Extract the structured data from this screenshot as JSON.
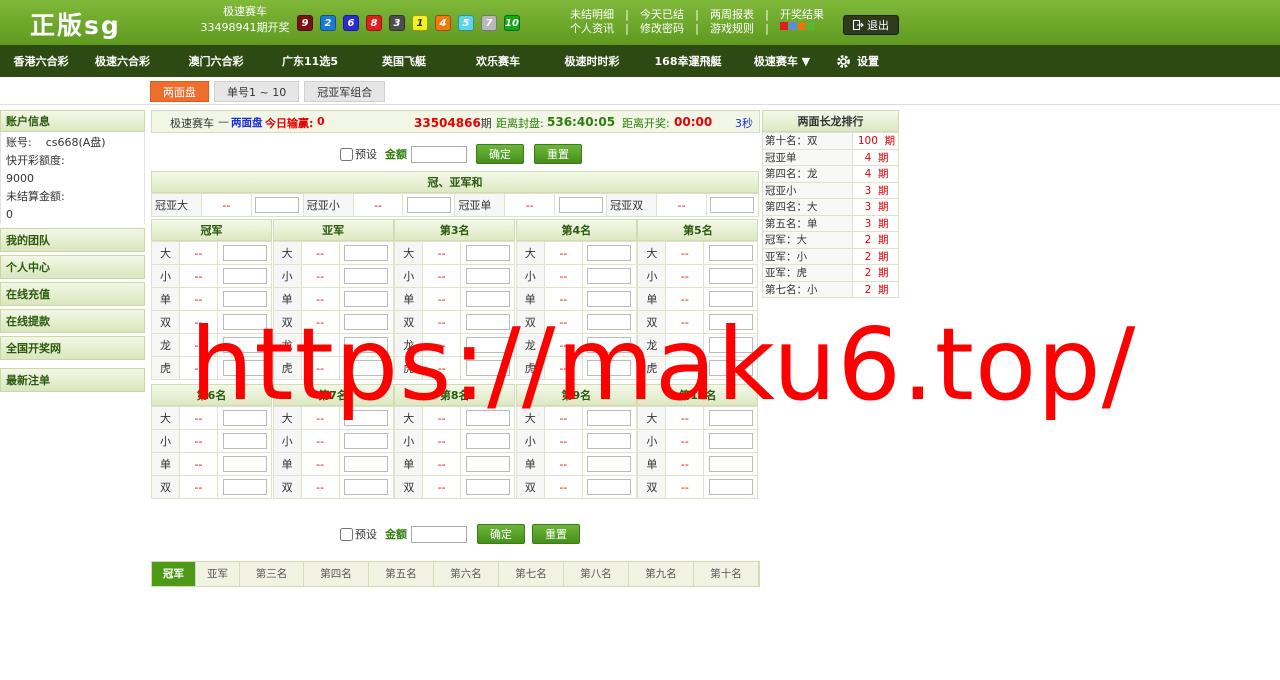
{
  "header": {
    "logo": "正版sg",
    "game_name": "极速赛车",
    "issue_text": "33498941期开奖",
    "balls": [
      {
        "n": "9",
        "color": "#7a0f0f"
      },
      {
        "n": "2",
        "color": "#1a7ad6"
      },
      {
        "n": "6",
        "color": "#2b2bd6"
      },
      {
        "n": "8",
        "color": "#e31d1d"
      },
      {
        "n": "3",
        "color": "#4d4d4d"
      },
      {
        "n": "1",
        "color": "#f3f024"
      },
      {
        "n": "4",
        "color": "#f07a10"
      },
      {
        "n": "5",
        "color": "#5ad6e8"
      },
      {
        "n": "7",
        "color": "#b8b8b8"
      },
      {
        "n": "10",
        "color": "#14a814"
      }
    ],
    "links_row1": [
      "未结明细",
      "今天已结",
      "两周报表",
      "开奖结果"
    ],
    "links_row2": [
      "个人资讯",
      "修改密码",
      "游戏规则"
    ],
    "logout": "退出"
  },
  "nav": {
    "items": [
      "香港六合彩",
      "极速六合彩",
      "澳门六合彩",
      "广东11选5",
      "英国飞艇",
      "欢乐赛车",
      "极速时时彩",
      "168幸運飛艇",
      "极速赛车 ▼"
    ],
    "settings": "设置"
  },
  "tabs": [
    "两面盘",
    "单号1 ~ 10",
    "冠亚军组合"
  ],
  "sidebar": {
    "account_title": "账户信息",
    "account_label": "账号:",
    "account_value": "cs668(A盘)",
    "quota_label": "快开彩额度:",
    "quota_value": "9000",
    "unsettled_label": "未结算金额:",
    "unsettled_value": "0",
    "menu": [
      "我的团队",
      "个人中心",
      "在线充值",
      "在线提款",
      "全国开奖网",
      "最新注单"
    ]
  },
  "infobar": {
    "game": "极速赛车",
    "dash": "—",
    "mode": "两面盘",
    "profit_label": "今日输赢:",
    "profit_value": "0",
    "period": "33504866",
    "period_suffix": "期",
    "close_label": "距离封盘:",
    "close_value": "536:40:05",
    "draw_label": "距离开奖:",
    "draw_value": "00:00",
    "refresh": "3秒"
  },
  "bet_controls": {
    "preset_label": "预设",
    "amount_label": "金额",
    "confirm": "确定",
    "reset": "重置"
  },
  "combo": {
    "title": "冠、亚军和",
    "items": [
      {
        "label": "冠亚大",
        "odds": "--"
      },
      {
        "label": "冠亚小",
        "odds": "--"
      },
      {
        "label": "冠亚单",
        "odds": "--"
      },
      {
        "label": "冠亚双",
        "odds": "--"
      }
    ]
  },
  "positions_top": {
    "names": [
      "冠军",
      "亚军",
      "第3名",
      "第4名",
      "第5名"
    ],
    "options": [
      "大",
      "小",
      "单",
      "双",
      "龙",
      "虎"
    ],
    "odds": "--"
  },
  "positions_bottom": {
    "names": [
      "第6名",
      "第7名",
      "第8名",
      "第9名",
      "第10名"
    ],
    "options": [
      "大",
      "小",
      "单",
      "双"
    ],
    "odds": "--"
  },
  "ranking": {
    "title": "两面长龙排行",
    "rows": [
      {
        "name": "第十名：双",
        "count": "100",
        "unit": "期"
      },
      {
        "name": "冠亚单",
        "count": "4",
        "unit": "期"
      },
      {
        "name": "第四名：龙",
        "count": "4",
        "unit": "期"
      },
      {
        "name": "冠亚小",
        "count": "3",
        "unit": "期"
      },
      {
        "name": "第四名：大",
        "count": "3",
        "unit": "期"
      },
      {
        "name": "第五名：单",
        "count": "3",
        "unit": "期"
      },
      {
        "name": "冠军：大",
        "count": "2",
        "unit": "期"
      },
      {
        "name": "亚军：小",
        "count": "2",
        "unit": "期"
      },
      {
        "name": "亚军：虎",
        "count": "2",
        "unit": "期"
      },
      {
        "name": "第七名：小",
        "count": "2",
        "unit": "期"
      }
    ]
  },
  "bottom_tabs": [
    "冠军",
    "亚军",
    "第三名",
    "第四名",
    "第五名",
    "第六名",
    "第七名",
    "第八名",
    "第九名",
    "第十名"
  ],
  "watermark": "https://maku6.top/"
}
